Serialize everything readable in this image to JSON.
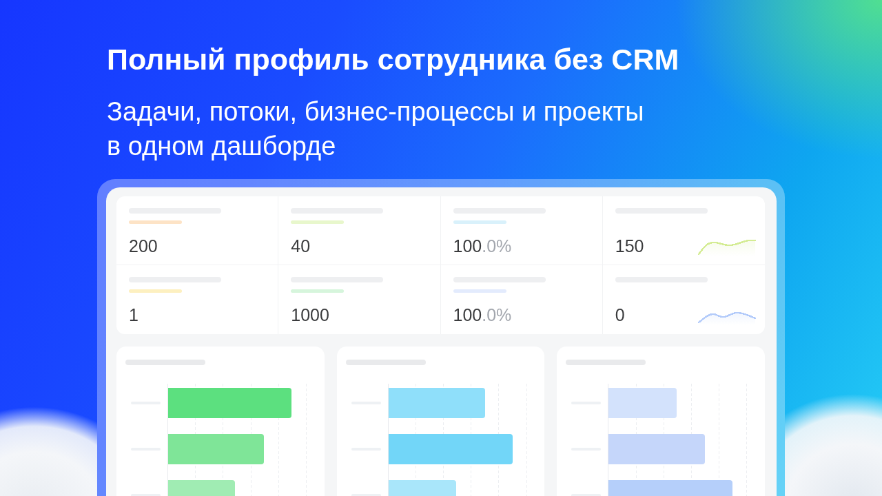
{
  "headline": "Полный профиль сотрудника без CRM",
  "subtitle": "Задачи, потоки, бизнес-процессы и проекты\nв одном дашборде",
  "stats": [
    {
      "kind": "plain",
      "value": "200",
      "color": "#fde3c6"
    },
    {
      "kind": "plain",
      "value": "40",
      "color": "#e8f7cc"
    },
    {
      "kind": "plain",
      "value": "100",
      "suffix": ".0%",
      "color": "#d9f1fb"
    },
    {
      "kind": "sparkline",
      "value": "150",
      "color": "#d4ec94"
    },
    {
      "kind": "plain",
      "value": "1",
      "color": "#fdf0c0"
    },
    {
      "kind": "plain",
      "value": "1000",
      "color": "#d6f5dc"
    },
    {
      "kind": "plain",
      "value": "100",
      "suffix": ".0%",
      "color": "#e3ebfd"
    },
    {
      "kind": "sparkline",
      "value": "0",
      "color": "#b3cbfa"
    }
  ],
  "bar_charts": [
    {
      "bars": [
        {
          "color": "#5ce07f"
        },
        {
          "color": "#7fe598"
        },
        {
          "color": "#a0ecb3"
        }
      ]
    },
    {
      "bars": [
        {
          "color": "#8fdffa"
        },
        {
          "color": "#72d6f8"
        },
        {
          "color": "#a9e6fa"
        }
      ]
    },
    {
      "bars": [
        {
          "color": "#d3e2fc"
        },
        {
          "color": "#c5d6fa"
        },
        {
          "color": "#b5cffa"
        }
      ]
    }
  ]
}
